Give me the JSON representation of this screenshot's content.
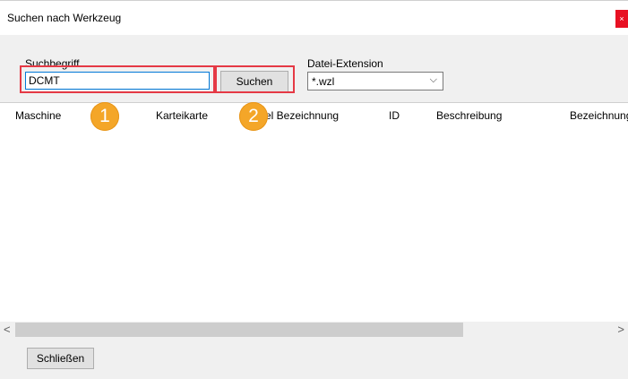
{
  "window": {
    "title": "Suchen nach Werkzeug",
    "close_glyph": "×"
  },
  "search": {
    "term_label": "Suchbegriff",
    "term_value": "DCMT",
    "button_label": "Suchen",
    "extension_label": "Datei-Extension",
    "extension_value": "*.wzl",
    "extension_chevron": "⌵"
  },
  "table": {
    "columns": [
      "Maschine",
      "Karteikarte",
      "el Bezeichnung",
      "ID",
      "Beschreibung",
      "Bezeichnung"
    ]
  },
  "scrollbar": {
    "left": "<",
    "right": ">"
  },
  "footer": {
    "close_label": "Schließen"
  },
  "annotations": {
    "marker_1": "1",
    "marker_2": "2",
    "highlight_color": "#e53945",
    "badge_color": "#f4a628"
  }
}
